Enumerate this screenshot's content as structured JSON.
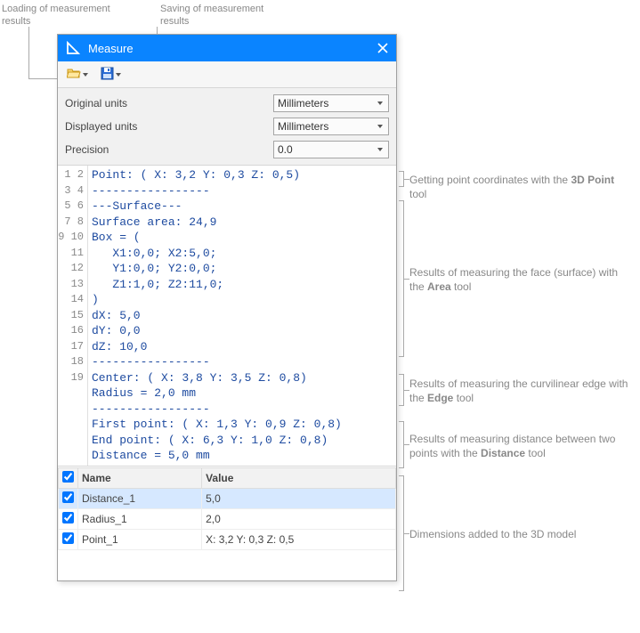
{
  "top_annotations": {
    "load": "Loading of measurement results",
    "save": "Saving of measurement results"
  },
  "dialog": {
    "title": "Measure",
    "toolbar": {
      "open_tooltip": "Open",
      "save_tooltip": "Save"
    },
    "settings": {
      "original_units_label": "Original units",
      "original_units_value": "Millimeters",
      "displayed_units_label": "Displayed units",
      "displayed_units_value": "Millimeters",
      "precision_label": "Precision",
      "precision_value": "0.0"
    }
  },
  "code_lines": [
    "Point: ( X: 3,2 Y: 0,3 Z: 0,5)",
    "-----------------",
    "---Surface---",
    "Surface area: 24,9",
    "Box = (",
    "   X1:0,0; X2:5,0;",
    "   Y1:0,0; Y2:0,0;",
    "   Z1:1,0; Z2:11,0;",
    ")",
    "dX: 5,0",
    "dY: 0,0",
    "dZ: 10,0",
    "-----------------",
    "Center: ( X: 3,8 Y: 3,5 Z: 0,8)",
    "Radius = 2,0 mm",
    "-----------------",
    "First point: ( X: 1,3 Y: 0,9 Z: 0,8)",
    "End point: ( X: 6,3 Y: 1,0 Z: 0,8)",
    "Distance = 5,0 mm"
  ],
  "grid": {
    "header_checkbox": true,
    "columns": {
      "name": "Name",
      "value": "Value"
    },
    "rows": [
      {
        "checked": true,
        "name": "Distance_1",
        "value": "5,0",
        "selected": true
      },
      {
        "checked": true,
        "name": "Radius_1",
        "value": "2,0",
        "selected": false
      },
      {
        "checked": true,
        "name": "Point_1",
        "value": "X: 3,2 Y: 0,3 Z: 0,5",
        "selected": false
      }
    ]
  },
  "right_annotations": {
    "r1_a": "Getting point coordinates with the ",
    "r1_b": "3D Point",
    "r1_c": " tool",
    "r2_a": "Results of measuring the face (surface) with the ",
    "r2_b": "Area",
    "r2_c": " tool",
    "r3_a": "Results of measuring the curvilinear edge with the ",
    "r3_b": "Edge",
    "r3_c": " tool",
    "r4_a": "Results of measuring distance between two points with the ",
    "r4_b": "Distance",
    "r4_c": " tool",
    "r5": "Dimensions added to the 3D model"
  }
}
